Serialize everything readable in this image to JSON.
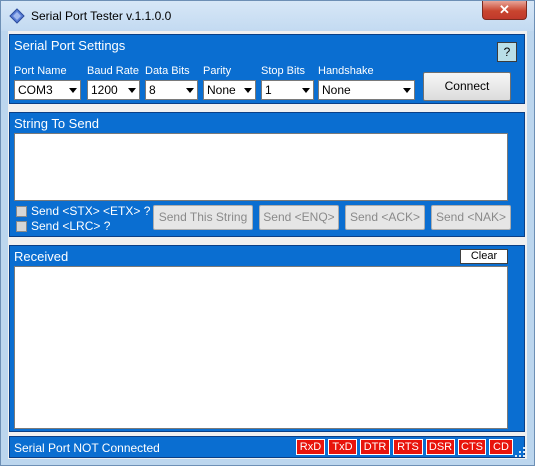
{
  "window": {
    "title": "Serial Port Tester v.1.1.0.0",
    "close_label": "✕"
  },
  "settings": {
    "label": "Serial Port Settings",
    "help_label": "?",
    "fields": [
      {
        "label": "Port Name",
        "value": "COM3"
      },
      {
        "label": "Baud Rate",
        "value": "1200"
      },
      {
        "label": "Data Bits",
        "value": "8"
      },
      {
        "label": "Parity",
        "value": "None"
      },
      {
        "label": "Stop Bits",
        "value": "1"
      },
      {
        "label": "Handshake",
        "value": "None"
      }
    ],
    "connect_label": "Connect"
  },
  "send": {
    "label": "String To Send",
    "options": [
      {
        "label": "Send <STX> <ETX> ?",
        "checked": false
      },
      {
        "label": "Send <LRC> ?",
        "checked": false
      }
    ],
    "buttons": [
      "Send This String",
      "Send <ENQ>",
      "Send <ACK>",
      "Send <NAK>"
    ]
  },
  "received": {
    "label": "Received",
    "clear_label": "Clear"
  },
  "status": {
    "text": "Serial Port NOT Connected",
    "indicators": [
      "RxD",
      "TxD",
      "DTR",
      "RTS",
      "DSR",
      "CTS",
      "CD"
    ],
    "indicator_color": "#e8140c"
  },
  "colors": {
    "panel": "#0a6ed1",
    "titlebar": "#c3daf1"
  }
}
